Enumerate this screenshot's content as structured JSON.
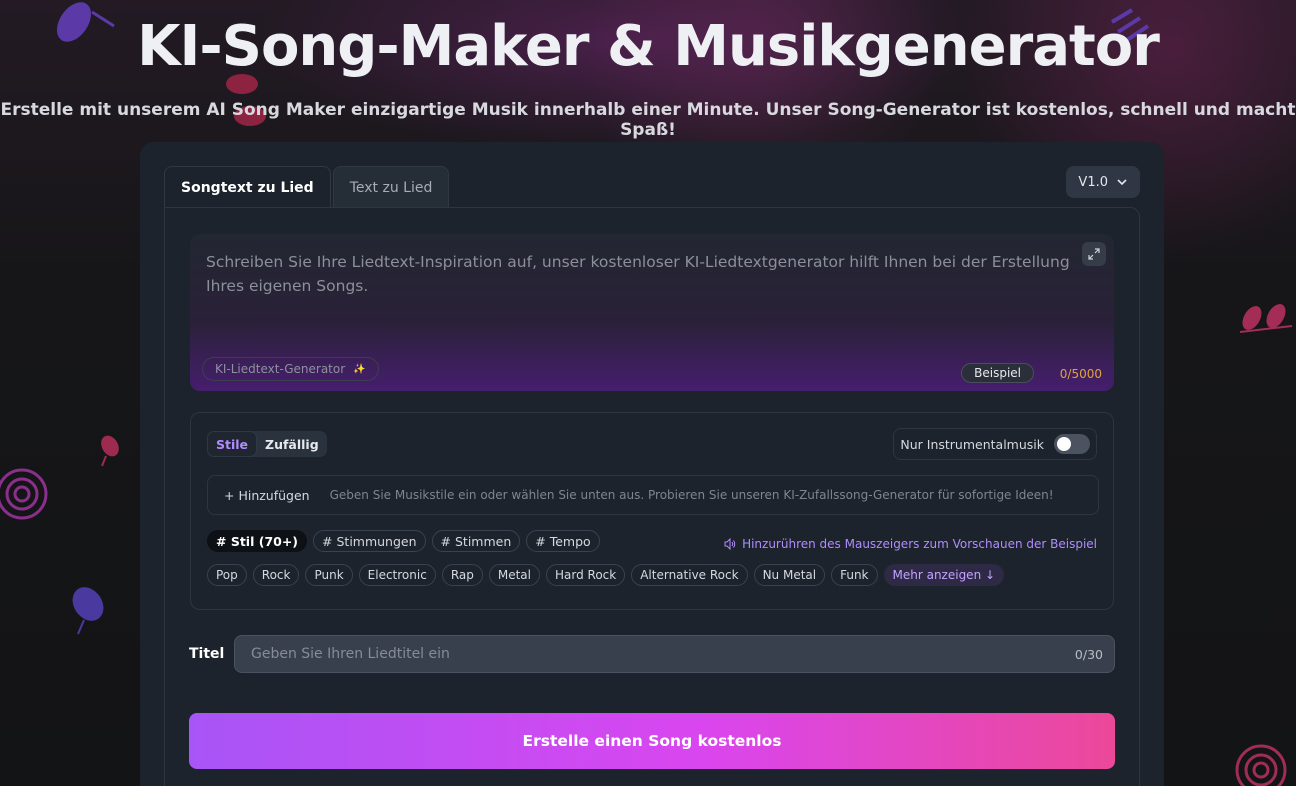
{
  "hero": {
    "title": "KI-Song-Maker & Musikgenerator",
    "subtitle": "Erstelle mit unserem AI Song Maker einzigartige Musik innerhalb einer Minute. Unser Song-Generator ist kostenlos, schnell und macht Spaß!"
  },
  "tabs": [
    {
      "label": "Songtext zu Lied",
      "active": true
    },
    {
      "label": "Text zu Lied",
      "active": false
    }
  ],
  "version": {
    "label": "V1.0",
    "icon": "chevron-down-icon"
  },
  "lyrics": {
    "placeholder": "Schreiben Sie Ihre Liedtext-Inspiration auf, unser kostenloser KI-Liedtextgenerator hilft Ihnen bei der Erstellung Ihres eigenen Songs.",
    "generator_label": "KI-Liedtext-Generator",
    "generator_icon": "✨",
    "example_label": "Beispiel",
    "counter": "0/5000"
  },
  "styles": {
    "seg_styles": "Stile",
    "seg_random": "Zufällig",
    "instrumental_label": "Nur Instrumentalmusik",
    "add_label": "+ Hinzufügen",
    "add_placeholder": "Geben Sie Musikstile ein oder wählen Sie unten aus. Probieren Sie unseren KI-Zufallssong-Generator für sofortige Ideen!",
    "categories": [
      "# Stil (70+)",
      "# Stimmungen",
      "# Stimmen",
      "# Tempo"
    ],
    "hover_hint": "Hinzurühren des Mauszeigers zum Vorschauen der Beispiel",
    "genres": [
      "Pop",
      "Rock",
      "Punk",
      "Electronic",
      "Rap",
      "Metal",
      "Hard Rock",
      "Alternative Rock",
      "Nu Metal",
      "Funk"
    ],
    "more_label": "Mehr anzeigen ↓"
  },
  "title_field": {
    "label": "Titel",
    "placeholder": "Geben Sie Ihren Liedtitel ein",
    "counter": "0/30"
  },
  "create_button": "Erstelle einen Song kostenlos",
  "colors": {
    "accent_purple": "#a855f7",
    "accent_pink": "#ec4899",
    "counter_orange": "#e0a33a"
  }
}
